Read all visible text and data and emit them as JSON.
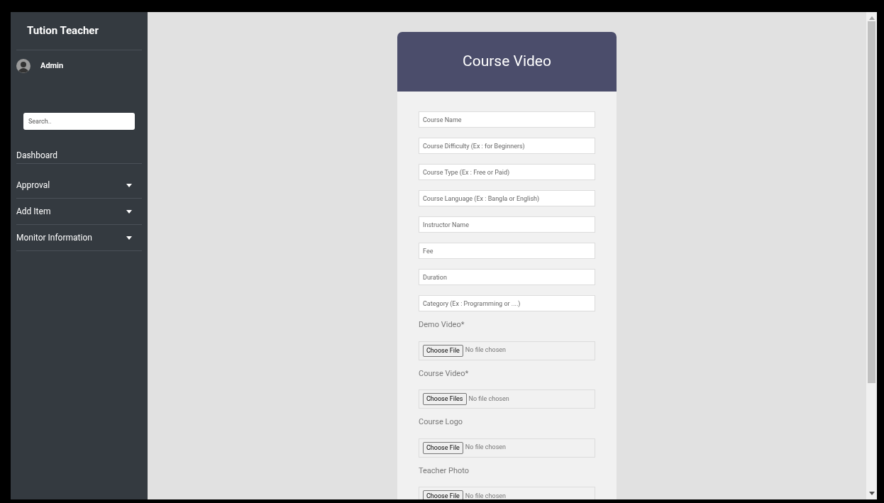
{
  "sidebar": {
    "brand": "Tution Teacher",
    "user": "Admin",
    "search": {
      "placeholder": "Search.."
    },
    "items": [
      {
        "label": "Dashboard",
        "kind": "link"
      },
      {
        "label": "Approval",
        "kind": "dropdown"
      },
      {
        "label": "Add Item",
        "kind": "dropdown"
      },
      {
        "label": "Monitor Information",
        "kind": "dropdown"
      }
    ]
  },
  "form": {
    "title": "Course Video",
    "fields": [
      {
        "kind": "text",
        "placeholder": "Course Name"
      },
      {
        "kind": "text",
        "placeholder": "Course Difficulty (Ex : for Beginners)"
      },
      {
        "kind": "text",
        "placeholder": "Course Type (Ex : Free or Paid)"
      },
      {
        "kind": "text",
        "placeholder": "Course Language (Ex : Bangla or English)"
      },
      {
        "kind": "text",
        "placeholder": "Instructor Name"
      },
      {
        "kind": "text",
        "placeholder": "Fee"
      },
      {
        "kind": "text",
        "placeholder": "Duration"
      },
      {
        "kind": "text",
        "placeholder": "Category (Ex : Programming or ....)"
      },
      {
        "kind": "file",
        "label": "Demo Video*",
        "button": "Choose File",
        "status": "No file chosen"
      },
      {
        "kind": "file",
        "label": "Course Video*",
        "button": "Choose Files",
        "status": "No file chosen"
      },
      {
        "kind": "file",
        "label": "Course Logo",
        "button": "Choose File",
        "status": "No file chosen"
      },
      {
        "kind": "file",
        "label": "Teacher Photo",
        "button": "Choose File",
        "status": "No file chosen"
      }
    ]
  }
}
